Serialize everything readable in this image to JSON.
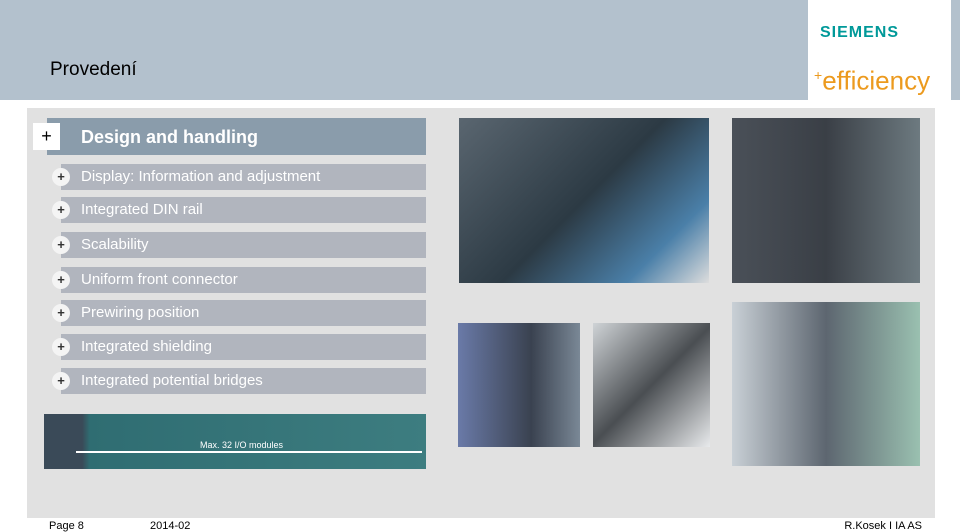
{
  "header": {
    "title": "Provedení",
    "logo": "SIEMENS",
    "tagline": "+efficiency"
  },
  "main": {
    "heading": "Design and handling",
    "plus": "+",
    "items": [
      "Display: Information and adjustment",
      "Integrated DIN rail",
      "Scalability",
      "Uniform front connector",
      "Prewiring position",
      "Integrated shielding",
      "Integrated potential bridges"
    ]
  },
  "rack": {
    "label": "Max. 32 I/O modules"
  },
  "footer": {
    "page": "Page 8",
    "date": "2014-02",
    "author": "R.Kosek I IA AS"
  },
  "colors": {
    "header": "#b3c1cd",
    "mainbar": "#8a9cab",
    "item": "#b1b5be",
    "brand": "#009999",
    "accent": "#ec9a1e"
  }
}
